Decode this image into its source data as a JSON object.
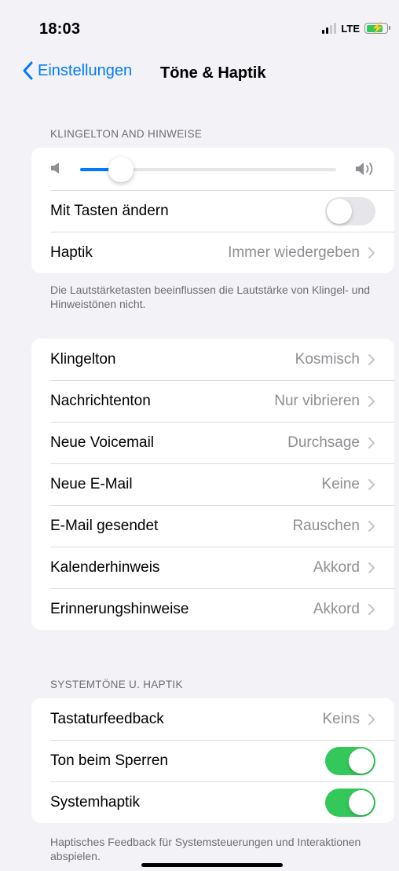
{
  "status_bar": {
    "time": "18:03",
    "network": "LTE",
    "signal_bars": 2,
    "signal_total": 4,
    "battery_charging": true
  },
  "nav": {
    "back_label": "Einstellungen",
    "title": "Töne & Haptik"
  },
  "ringer_section": {
    "header": "KLINGELTON AND HINWEISE",
    "volume_level": 0.16,
    "change_with_buttons": {
      "label": "Mit Tasten ändern",
      "on": false
    },
    "haptics": {
      "label": "Haptik",
      "value": "Immer wiedergeben"
    },
    "footer": "Die Lautstärketasten beeinflussen die Lautstärke von Klingel- und Hinweistönen nicht."
  },
  "sounds": [
    {
      "label": "Klingelton",
      "value": "Kosmisch"
    },
    {
      "label": "Nachrichtenton",
      "value": "Nur vibrieren"
    },
    {
      "label": "Neue Voicemail",
      "value": "Durchsage"
    },
    {
      "label": "Neue E-Mail",
      "value": "Keine"
    },
    {
      "label": "E-Mail gesendet",
      "value": "Rauschen"
    },
    {
      "label": "Kalenderhinweis",
      "value": "Akkord"
    },
    {
      "label": "Erinnerungshinweise",
      "value": "Akkord"
    }
  ],
  "system_section": {
    "header": "SYSTEMTÖNE U. HAPTIK",
    "keyboard_feedback": {
      "label": "Tastaturfeedback",
      "value": "Keins"
    },
    "lock_sound": {
      "label": "Ton beim Sperren",
      "on": true
    },
    "system_haptics": {
      "label": "Systemhaptik",
      "on": true
    },
    "footer": "Haptisches Feedback für Systemsteuerungen und Interaktionen abspielen."
  },
  "colors": {
    "accent": "#007aff",
    "toggle_on": "#34c759",
    "background": "#f2f2f7",
    "secondary_text": "#8e8e93"
  }
}
